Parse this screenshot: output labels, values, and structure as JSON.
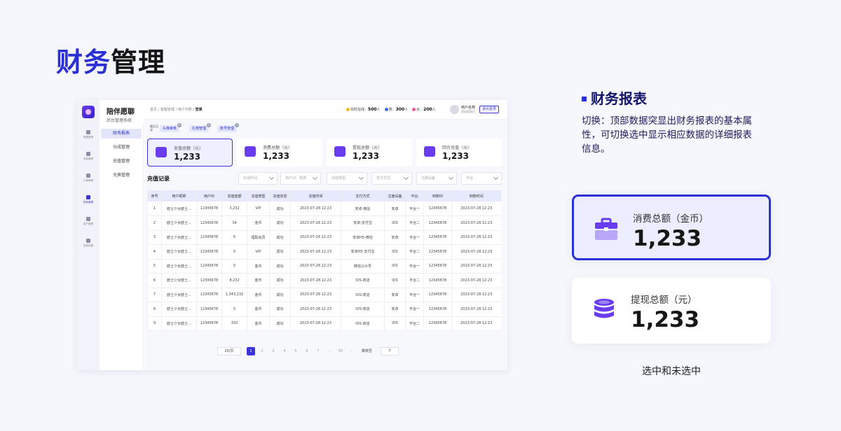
{
  "page_title": {
    "part1": "财务",
    "part2": "管理"
  },
  "app": {
    "name": "陪伴愿聊",
    "subtitle": "后台管理系统"
  },
  "rail": [
    {
      "label": "数据管理",
      "active": false
    },
    {
      "label": "系统管理",
      "active": false
    },
    {
      "label": "订单管理",
      "active": false
    },
    {
      "label": "财务管理",
      "active": true
    },
    {
      "label": "用户管理",
      "active": false
    },
    {
      "label": "系统设置",
      "active": false
    }
  ],
  "submenu": [
    {
      "label": "财务报表",
      "active": true
    },
    {
      "label": "分成管理",
      "active": false
    },
    {
      "label": "充值管理",
      "active": false
    },
    {
      "label": "兑换管理",
      "active": false
    }
  ],
  "breadcrumb": {
    "home": "首页",
    "sep": "/",
    "items": [
      "客服管理",
      "用户列表",
      "登录"
    ]
  },
  "stats": [
    {
      "label": "实时在线：",
      "value": "500",
      "unit": "人",
      "color": "#f5b623"
    },
    {
      "label": "男：",
      "value": "300",
      "unit": "人",
      "color": "#3a6cf0"
    },
    {
      "label": "女：",
      "value": "200",
      "unit": "人",
      "color": "#f05a9a"
    }
  ],
  "user": {
    "name": "用户名称",
    "role": "超级管理员",
    "logout": "退出登录"
  },
  "recent": {
    "label": "最近记录",
    "tags": [
      "头像审核",
      "礼物管理",
      "账号管理"
    ]
  },
  "cards": [
    {
      "label": "充值总额（元）",
      "value": "1,233",
      "selected": true,
      "icon": "wallet-icon"
    },
    {
      "label": "消费总额（元）",
      "value": "1,233",
      "selected": false,
      "icon": "briefcase-icon"
    },
    {
      "label": "提现总额（元）",
      "value": "1,233",
      "selected": false,
      "icon": "coins-icon"
    },
    {
      "label": "回台充值（元）",
      "value": "1,233",
      "selected": false,
      "icon": "cubes-icon"
    }
  ],
  "records_title": "充值记录",
  "filters": [
    "充值时间",
    "用户ID、昵称",
    "充值类型",
    "支付方式",
    "注册设备",
    "平台"
  ],
  "table": {
    "headers": [
      "序号",
      "用户昵称",
      "用户ID",
      "充值金额",
      "充值类型",
      "充值状态",
      "充值时间",
      "支付方式",
      "注册设备",
      "平台",
      "到账ID",
      "到账时间"
    ],
    "rows": [
      [
        "1",
        "欧士少女欧士...",
        "12345678",
        "3,232",
        "VIP",
        "成功",
        "2023-07-28 12:23",
        "安卓-微信",
        "安卓",
        "平台一",
        "12345678",
        "2023-07-28 12:23"
      ],
      [
        "2",
        "欧士少女欧士...",
        "12345678",
        "34",
        "金币",
        "成功",
        "2023-07-28 12:23",
        "安卓-支付宝",
        "IOS",
        "平台二",
        "12345678",
        "2023-07-28 12:23"
      ],
      [
        "3",
        "欧士少女欧士...",
        "12345678",
        "6",
        "理配会员",
        "成功",
        "2023-07-28 12:23",
        "安卓H5-微信",
        "安卓",
        "平台一",
        "12345678",
        "2023-07-28 12:23"
      ],
      [
        "4",
        "欧士少女欧士...",
        "12345678",
        "0",
        "VIP",
        "成功",
        "2023-07-28 12:23",
        "安卓H5-支付宝",
        "IOS",
        "平台二",
        "12345678",
        "2023-07-28 12:23"
      ],
      [
        "5",
        "欧士少女欧士...",
        "12345678",
        "0",
        "金币",
        "成功",
        "2023-07-28 12:23",
        "微信公众号",
        "IOS",
        "平台一",
        "12345678",
        "2023-07-28 12:23"
      ],
      [
        "6",
        "欧士少女欧士...",
        "12345678",
        "8,232",
        "金币",
        "成功",
        "2023-07-28 12:23",
        "IOS-商店",
        "IOS",
        "平台二",
        "12345678",
        "2023-07-28 12:23"
      ],
      [
        "7",
        "欧士少女欧士...",
        "12345678",
        "1,343,232",
        "金币",
        "成功",
        "2023-07-28 12:23",
        "IOS-商店",
        "安卓",
        "平台一",
        "12345678",
        "2023-07-28 12:23"
      ],
      [
        "8",
        "欧士少女欧士...",
        "12345678",
        "0",
        "金币",
        "成功",
        "2023-07-28 12:23",
        "IOS-商店",
        "安卓",
        "平台一",
        "12345678",
        "2023-07-28 12:23"
      ],
      [
        "9",
        "欧士少女欧士...",
        "12345678",
        "320",
        "金币",
        "成功",
        "2023-07-28 12:23",
        "IOS-商店",
        "IOS",
        "平台二",
        "12345678",
        "2023-07-28 12:23"
      ]
    ]
  },
  "pagination": {
    "page_size": "20/页",
    "pages": [
      "1",
      "2",
      "3",
      "4",
      "5",
      "6",
      "7",
      "···",
      "50",
      "›"
    ],
    "current": "1",
    "jump_label": "跳转至",
    "jump_value": "7"
  },
  "panel": {
    "section_title": "财务报表",
    "description": "切换：顶部数据突显出财务报表的基本属性，可切换选中显示相应数据的详细报表信息。",
    "card_selected": {
      "label": "消费总额（金币）",
      "value": "1,233"
    },
    "card_unselected": {
      "label": "提现总额（元）",
      "value": "1,233"
    },
    "caption": "选中和未选中"
  },
  "colors": {
    "accent": "#2b2fd6",
    "purple": "#6a3cf0",
    "header_bg": "#e7e9fc"
  }
}
